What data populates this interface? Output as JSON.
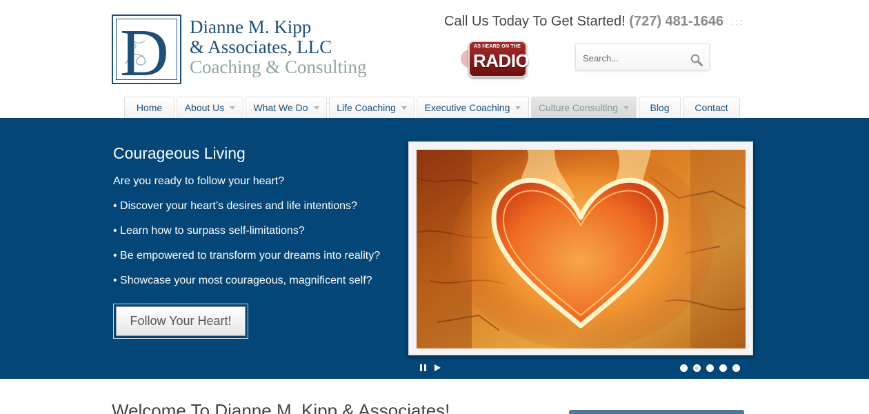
{
  "brand": {
    "logo_letter": "D",
    "line1": "Dianne M. Kipp",
    "line2": "& Associates, LLC",
    "line3": "Coaching & Consulting"
  },
  "header": {
    "call_text": "Call Us Today To Get Started!",
    "phone": "(727) 481-1646",
    "dots": ":::",
    "radio_small": "AS HEARD ON THE",
    "radio_big": "RADIO"
  },
  "search": {
    "placeholder": "Search..."
  },
  "nav": {
    "items": [
      {
        "label": "Home"
      },
      {
        "label": "About Us"
      },
      {
        "label": "What We Do"
      },
      {
        "label": "Life Coaching"
      },
      {
        "label": "Executive Coaching"
      },
      {
        "label": "Culture Consulting"
      },
      {
        "label": "Blog"
      },
      {
        "label": "Contact"
      }
    ]
  },
  "hero": {
    "title": "Courageous Living",
    "intro": "Are you ready to follow your heart?",
    "bullets": [
      "• Discover your heart’s desires and life intentions?",
      "• Learn how to surpass self-limitations?",
      "• Be empowered to transform your dreams into reality?",
      "• Showcase your most courageous, magnificent self?"
    ],
    "cta_label": "Follow Your Heart!",
    "slider": {
      "total_slides": 5,
      "active_slide": 2
    }
  },
  "main": {
    "welcome_heading": "Welcome To Dianne M. Kipp & Associates!"
  },
  "colors": {
    "brand_navy": "#1d4f78",
    "hero_bg": "#034677",
    "brand_sage": "#8fa5a4",
    "radio_red": "#8b1a1a"
  },
  "icons": {
    "search": "magnifier-icon",
    "pause": "pause-icon",
    "play": "play-icon",
    "caret": "caret-down-icon"
  }
}
